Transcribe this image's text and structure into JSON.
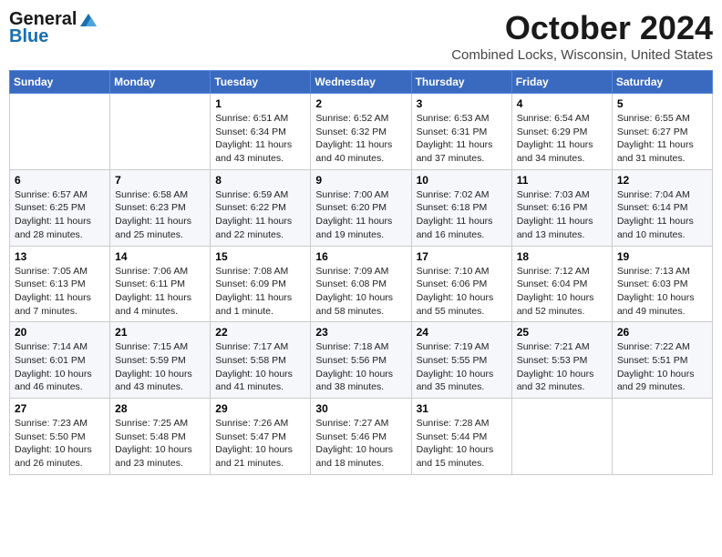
{
  "header": {
    "logo_general": "General",
    "logo_blue": "Blue",
    "title": "October 2024",
    "location": "Combined Locks, Wisconsin, United States"
  },
  "days_of_week": [
    "Sunday",
    "Monday",
    "Tuesday",
    "Wednesday",
    "Thursday",
    "Friday",
    "Saturday"
  ],
  "weeks": [
    [
      {
        "day": "",
        "info": ""
      },
      {
        "day": "",
        "info": ""
      },
      {
        "day": "1",
        "info": "Sunrise: 6:51 AM\nSunset: 6:34 PM\nDaylight: 11 hours and 43 minutes."
      },
      {
        "day": "2",
        "info": "Sunrise: 6:52 AM\nSunset: 6:32 PM\nDaylight: 11 hours and 40 minutes."
      },
      {
        "day": "3",
        "info": "Sunrise: 6:53 AM\nSunset: 6:31 PM\nDaylight: 11 hours and 37 minutes."
      },
      {
        "day": "4",
        "info": "Sunrise: 6:54 AM\nSunset: 6:29 PM\nDaylight: 11 hours and 34 minutes."
      },
      {
        "day": "5",
        "info": "Sunrise: 6:55 AM\nSunset: 6:27 PM\nDaylight: 11 hours and 31 minutes."
      }
    ],
    [
      {
        "day": "6",
        "info": "Sunrise: 6:57 AM\nSunset: 6:25 PM\nDaylight: 11 hours and 28 minutes."
      },
      {
        "day": "7",
        "info": "Sunrise: 6:58 AM\nSunset: 6:23 PM\nDaylight: 11 hours and 25 minutes."
      },
      {
        "day": "8",
        "info": "Sunrise: 6:59 AM\nSunset: 6:22 PM\nDaylight: 11 hours and 22 minutes."
      },
      {
        "day": "9",
        "info": "Sunrise: 7:00 AM\nSunset: 6:20 PM\nDaylight: 11 hours and 19 minutes."
      },
      {
        "day": "10",
        "info": "Sunrise: 7:02 AM\nSunset: 6:18 PM\nDaylight: 11 hours and 16 minutes."
      },
      {
        "day": "11",
        "info": "Sunrise: 7:03 AM\nSunset: 6:16 PM\nDaylight: 11 hours and 13 minutes."
      },
      {
        "day": "12",
        "info": "Sunrise: 7:04 AM\nSunset: 6:14 PM\nDaylight: 11 hours and 10 minutes."
      }
    ],
    [
      {
        "day": "13",
        "info": "Sunrise: 7:05 AM\nSunset: 6:13 PM\nDaylight: 11 hours and 7 minutes."
      },
      {
        "day": "14",
        "info": "Sunrise: 7:06 AM\nSunset: 6:11 PM\nDaylight: 11 hours and 4 minutes."
      },
      {
        "day": "15",
        "info": "Sunrise: 7:08 AM\nSunset: 6:09 PM\nDaylight: 11 hours and 1 minute."
      },
      {
        "day": "16",
        "info": "Sunrise: 7:09 AM\nSunset: 6:08 PM\nDaylight: 10 hours and 58 minutes."
      },
      {
        "day": "17",
        "info": "Sunrise: 7:10 AM\nSunset: 6:06 PM\nDaylight: 10 hours and 55 minutes."
      },
      {
        "day": "18",
        "info": "Sunrise: 7:12 AM\nSunset: 6:04 PM\nDaylight: 10 hours and 52 minutes."
      },
      {
        "day": "19",
        "info": "Sunrise: 7:13 AM\nSunset: 6:03 PM\nDaylight: 10 hours and 49 minutes."
      }
    ],
    [
      {
        "day": "20",
        "info": "Sunrise: 7:14 AM\nSunset: 6:01 PM\nDaylight: 10 hours and 46 minutes."
      },
      {
        "day": "21",
        "info": "Sunrise: 7:15 AM\nSunset: 5:59 PM\nDaylight: 10 hours and 43 minutes."
      },
      {
        "day": "22",
        "info": "Sunrise: 7:17 AM\nSunset: 5:58 PM\nDaylight: 10 hours and 41 minutes."
      },
      {
        "day": "23",
        "info": "Sunrise: 7:18 AM\nSunset: 5:56 PM\nDaylight: 10 hours and 38 minutes."
      },
      {
        "day": "24",
        "info": "Sunrise: 7:19 AM\nSunset: 5:55 PM\nDaylight: 10 hours and 35 minutes."
      },
      {
        "day": "25",
        "info": "Sunrise: 7:21 AM\nSunset: 5:53 PM\nDaylight: 10 hours and 32 minutes."
      },
      {
        "day": "26",
        "info": "Sunrise: 7:22 AM\nSunset: 5:51 PM\nDaylight: 10 hours and 29 minutes."
      }
    ],
    [
      {
        "day": "27",
        "info": "Sunrise: 7:23 AM\nSunset: 5:50 PM\nDaylight: 10 hours and 26 minutes."
      },
      {
        "day": "28",
        "info": "Sunrise: 7:25 AM\nSunset: 5:48 PM\nDaylight: 10 hours and 23 minutes."
      },
      {
        "day": "29",
        "info": "Sunrise: 7:26 AM\nSunset: 5:47 PM\nDaylight: 10 hours and 21 minutes."
      },
      {
        "day": "30",
        "info": "Sunrise: 7:27 AM\nSunset: 5:46 PM\nDaylight: 10 hours and 18 minutes."
      },
      {
        "day": "31",
        "info": "Sunrise: 7:28 AM\nSunset: 5:44 PM\nDaylight: 10 hours and 15 minutes."
      },
      {
        "day": "",
        "info": ""
      },
      {
        "day": "",
        "info": ""
      }
    ]
  ]
}
